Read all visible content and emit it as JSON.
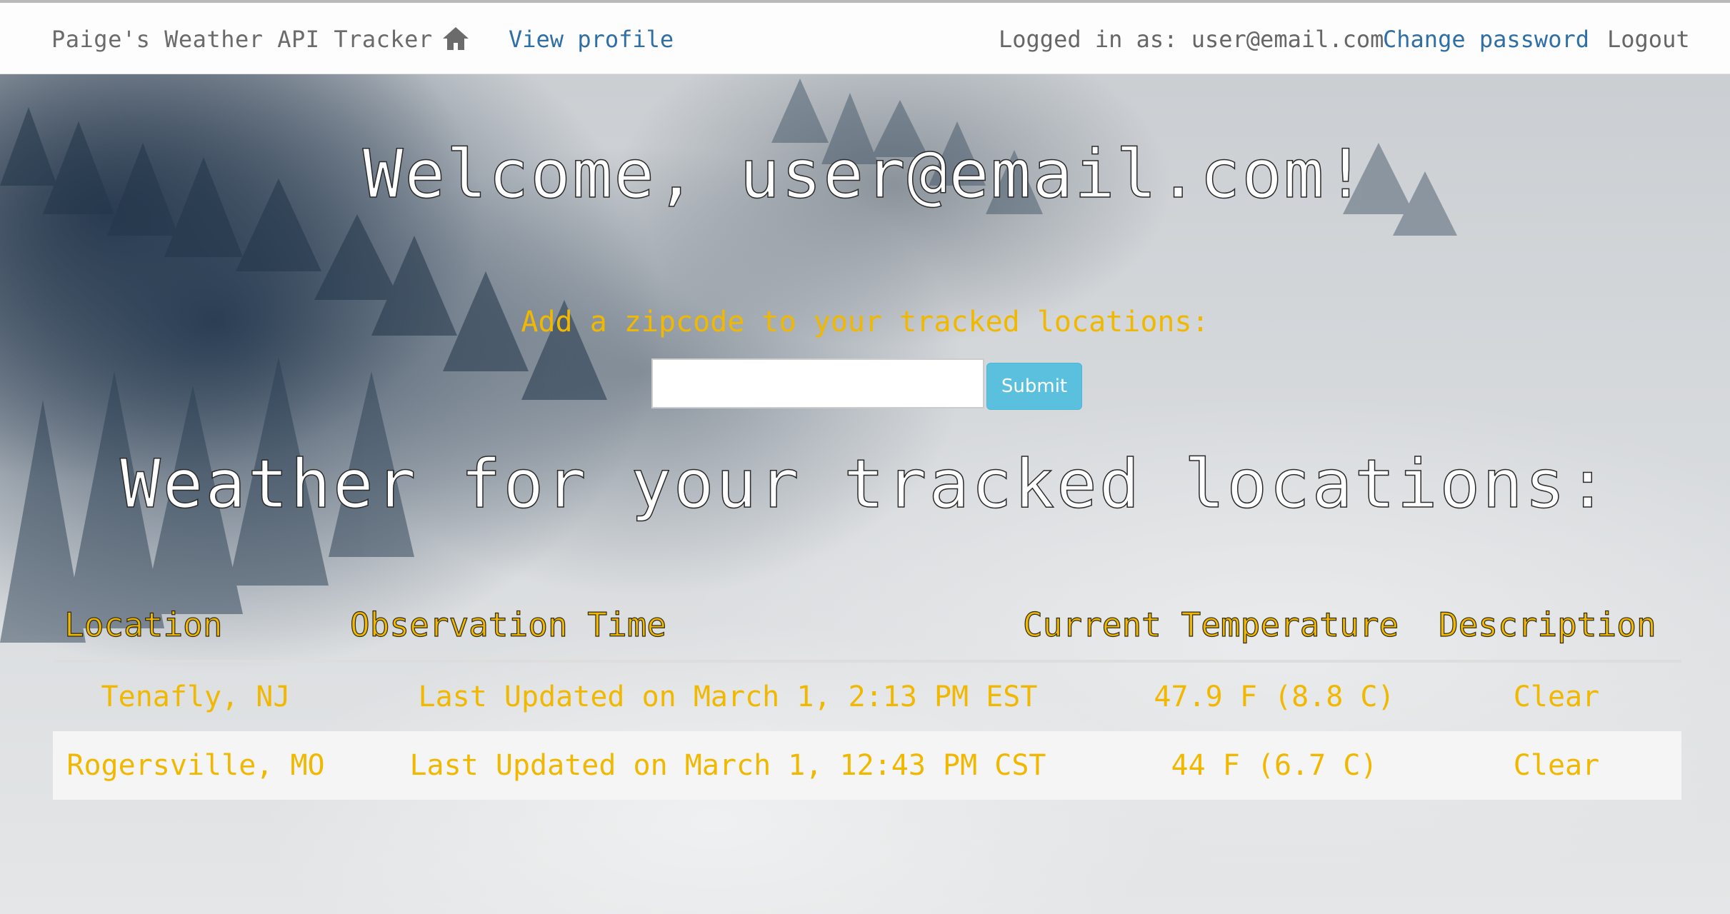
{
  "navbar": {
    "brand": "Paige's Weather API Tracker",
    "home_icon": "home-icon",
    "view_profile": "View profile",
    "logged_in_text": "Logged in as: user@email.com",
    "change_password": "Change password",
    "logout": "Logout"
  },
  "main": {
    "welcome": "Welcome, user@email.com!",
    "add_zip_label": "Add a zipcode to your tracked locations:",
    "zip_input_value": "",
    "submit_label": "Submit",
    "tracked_heading": "Weather for your tracked locations:"
  },
  "table": {
    "headers": {
      "location": "Location",
      "observation_time": "Observation Time",
      "current_temperature": "Current Temperature",
      "description": "Description"
    },
    "rows": [
      {
        "location": "Tenafly, NJ",
        "observation_time": "Last Updated on March 1, 2:13 PM EST",
        "temperature": "47.9 F (8.8 C)",
        "description": "Clear"
      },
      {
        "location": "Rogersville, MO",
        "observation_time": "Last Updated on March 1, 12:43 PM CST",
        "temperature": "44 F (6.7 C)",
        "description": "Clear"
      }
    ]
  },
  "colors": {
    "accent_yellow": "#f0b800",
    "link_blue": "#2f6fa6",
    "button_info": "#5bc0de"
  }
}
